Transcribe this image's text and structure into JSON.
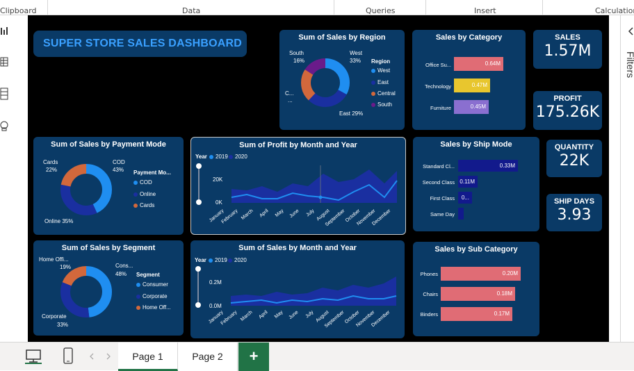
{
  "ribbon": {
    "groups": [
      "Clipboard",
      "Data",
      "Queries",
      "Insert",
      "Calculation"
    ]
  },
  "title": "SUPER STORE SALES DASHBOARD",
  "kpis": {
    "sales": {
      "label": "SALES",
      "value": "1.57M"
    },
    "profit": {
      "label": "PROFIT",
      "value": "175.26K"
    },
    "quantity": {
      "label": "QUANTITY",
      "value": "22K"
    },
    "ship_days": {
      "label": "SHIP DAYS",
      "value": "3.93"
    }
  },
  "region": {
    "title": "Sum of Sales by Region",
    "legend_title": "Region",
    "legend": [
      "West",
      "East",
      "Central",
      "South"
    ],
    "labels": {
      "south": "South",
      "south_pct": "16%",
      "west": "West",
      "west_pct": "33%",
      "central": "C...",
      "central_pct": "...",
      "east": "East 29%"
    }
  },
  "category": {
    "title": "Sales by Category",
    "items": [
      {
        "label": "Office Su...",
        "value": "0.64M"
      },
      {
        "label": "Technology",
        "value": "0.47M"
      },
      {
        "label": "Furniture",
        "value": "0.45M"
      }
    ]
  },
  "payment": {
    "title": "Sum of Sales by Payment Mode",
    "legend_title": "Payment Mo...",
    "legend": [
      "COD",
      "Online",
      "Cards"
    ],
    "labels": {
      "cards": "Cards",
      "cards_pct": "22%",
      "cod": "COD",
      "cod_pct": "43%",
      "online": "Online 35%"
    }
  },
  "profit_chart": {
    "title": "Sum of Profit by Month and Year",
    "year_label": "Year",
    "legend": [
      "2019",
      "2020"
    ],
    "y_ticks": [
      "20K",
      "0K"
    ],
    "months": [
      "January",
      "February",
      "March",
      "April",
      "May",
      "June",
      "July",
      "August",
      "September",
      "October",
      "November",
      "December"
    ]
  },
  "ship_mode": {
    "title": "Sales by Ship Mode",
    "items": [
      {
        "label": "Standard Cl...",
        "value": "0.33M"
      },
      {
        "label": "Second Class",
        "value": "0.11M"
      },
      {
        "label": "First Class",
        "value": "0..."
      },
      {
        "label": "Same Day",
        "value": ""
      }
    ]
  },
  "segment": {
    "title": "Sum of Sales by Segment",
    "legend_title": "Segment",
    "legend": [
      "Consumer",
      "Corporate",
      "Home Off..."
    ],
    "labels": {
      "home": "Home Offi...",
      "home_pct": "19%",
      "cons": "Cons...",
      "cons_pct": "48%",
      "corp": "Corporate",
      "corp_pct": "33%"
    }
  },
  "sales_chart": {
    "title": "Sum of Sales by Month and Year",
    "year_label": "Year",
    "legend": [
      "2019",
      "2020"
    ],
    "y_ticks": [
      "0.2M",
      "0.0M"
    ],
    "months": [
      "January",
      "February",
      "March",
      "April",
      "May",
      "June",
      "July",
      "August",
      "September",
      "October",
      "November",
      "December"
    ]
  },
  "sub_category": {
    "title": "Sales by Sub Category",
    "items": [
      {
        "label": "Phones",
        "value": "0.20M"
      },
      {
        "label": "Chairs",
        "value": "0.18M"
      },
      {
        "label": "Binders",
        "value": "0.17M"
      }
    ]
  },
  "right_pane": {
    "label": "Filters"
  },
  "tabs": [
    "Page 1",
    "Page 2"
  ],
  "add_tab": "+",
  "colors": {
    "card_bg": "#0a3a66",
    "blue_light": "#1f8ef1",
    "blue_dark": "#1a2fa0",
    "orange": "#d2683c",
    "purple": "#6a1b8a",
    "pink": "#e06c75",
    "yellow": "#e8c62e",
    "violet": "#8a6fd0",
    "navy_bar": "#121a8c"
  }
}
